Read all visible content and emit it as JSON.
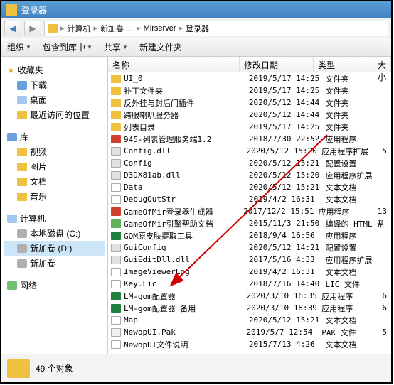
{
  "window": {
    "title": "登录器"
  },
  "address": {
    "parts": [
      "计算机",
      "新加卷 …",
      "Mirserver",
      "登录器"
    ]
  },
  "toolbar": {
    "organize": "组织",
    "include": "包含到库中",
    "share": "共享",
    "newfolder": "新建文件夹"
  },
  "sidebar": {
    "favorites": {
      "title": "收藏夹",
      "items": [
        "下载",
        "桌面",
        "最近访问的位置"
      ]
    },
    "libraries": {
      "title": "库",
      "items": [
        "视频",
        "图片",
        "文档",
        "音乐"
      ]
    },
    "computer": {
      "title": "计算机",
      "items": [
        "本地磁盘 (C:)",
        "新加卷 (D:)",
        "新加卷"
      ]
    },
    "network": {
      "title": "网络"
    }
  },
  "columns": {
    "name": "名称",
    "date": "修改日期",
    "type": "类型",
    "size": "大小"
  },
  "files": [
    {
      "icon": "folder",
      "name": "UI_0",
      "date": "2019/5/17 14:25",
      "type": "文件夹",
      "size": ""
    },
    {
      "icon": "folder",
      "name": "补丁文件夹",
      "date": "2019/5/17 14:25",
      "type": "文件夹",
      "size": ""
    },
    {
      "icon": "folder",
      "name": "反外挂与封后门插件",
      "date": "2020/5/12 14:44",
      "type": "文件夹",
      "size": ""
    },
    {
      "icon": "folder",
      "name": "跨服喇叭服务器",
      "date": "2020/5/12 14:44",
      "type": "文件夹",
      "size": ""
    },
    {
      "icon": "folder",
      "name": "列表目录",
      "date": "2019/5/17 14:25",
      "type": "文件夹",
      "size": ""
    },
    {
      "icon": "exe",
      "name": "945-列表管理服务端1.2",
      "date": "2018/7/30 22:52",
      "type": "应用程序",
      "size": ""
    },
    {
      "icon": "dll",
      "name": "Config.dll",
      "date": "2020/5/12 15:20",
      "type": "应用程序扩展",
      "size": "5"
    },
    {
      "icon": "cfg",
      "name": "Config",
      "date": "2020/5/12 15:21",
      "type": "配置设置",
      "size": ""
    },
    {
      "icon": "dll",
      "name": "D3DX81ab.dll",
      "date": "2020/5/12 15:20",
      "type": "应用程序扩展",
      "size": ""
    },
    {
      "icon": "txt",
      "name": "Data",
      "date": "2020/5/12 15:21",
      "type": "文本文档",
      "size": ""
    },
    {
      "icon": "txt",
      "name": "DebugOutStr",
      "date": "2019/4/2 16:31",
      "type": "文本文档",
      "size": ""
    },
    {
      "icon": "exe",
      "name": "GameOfMir登录器生成器",
      "date": "2017/12/2 15:51",
      "type": "应用程序",
      "size": "13"
    },
    {
      "icon": "chm",
      "name": "GameOfMir引擎帮助文档",
      "date": "2015/11/3 21:50",
      "type": "编译的 HTML 帮",
      "size": ""
    },
    {
      "icon": "exe2",
      "name": "GOM原皮肤提取工具",
      "date": "2018/9/4 16:56",
      "type": "应用程序",
      "size": ""
    },
    {
      "icon": "cfg",
      "name": "GuiConfig",
      "date": "2020/5/12 14:21",
      "type": "配置设置",
      "size": ""
    },
    {
      "icon": "dll",
      "name": "GuiEditDll.dll",
      "date": "2017/5/16 4:33",
      "type": "应用程序扩展",
      "size": ""
    },
    {
      "icon": "txt",
      "name": "ImageViewerLog",
      "date": "2019/4/2 16:31",
      "type": "文本文档",
      "size": ""
    },
    {
      "icon": "txt",
      "name": "Key.Lic",
      "date": "2018/7/16 14:40",
      "type": "LIC 文件",
      "size": ""
    },
    {
      "icon": "exe2",
      "name": "LM-gom配置器",
      "date": "2020/3/10 16:35",
      "type": "应用程序",
      "size": "6"
    },
    {
      "icon": "exe2",
      "name": "LM-gom配置器_备用",
      "date": "2020/3/10 18:39",
      "type": "应用程序",
      "size": "6"
    },
    {
      "icon": "txt",
      "name": "Map",
      "date": "2020/5/12 15:21",
      "type": "文本文档",
      "size": ""
    },
    {
      "icon": "pak",
      "name": "NewopUI.Pak",
      "date": "2019/5/7 12:54",
      "type": "PAK 文件",
      "size": "5"
    },
    {
      "icon": "txt",
      "name": "NewopUI文件说明",
      "date": "2015/7/13 4:26",
      "type": "文本文档",
      "size": ""
    }
  ],
  "status": {
    "count": "49 个对象"
  }
}
